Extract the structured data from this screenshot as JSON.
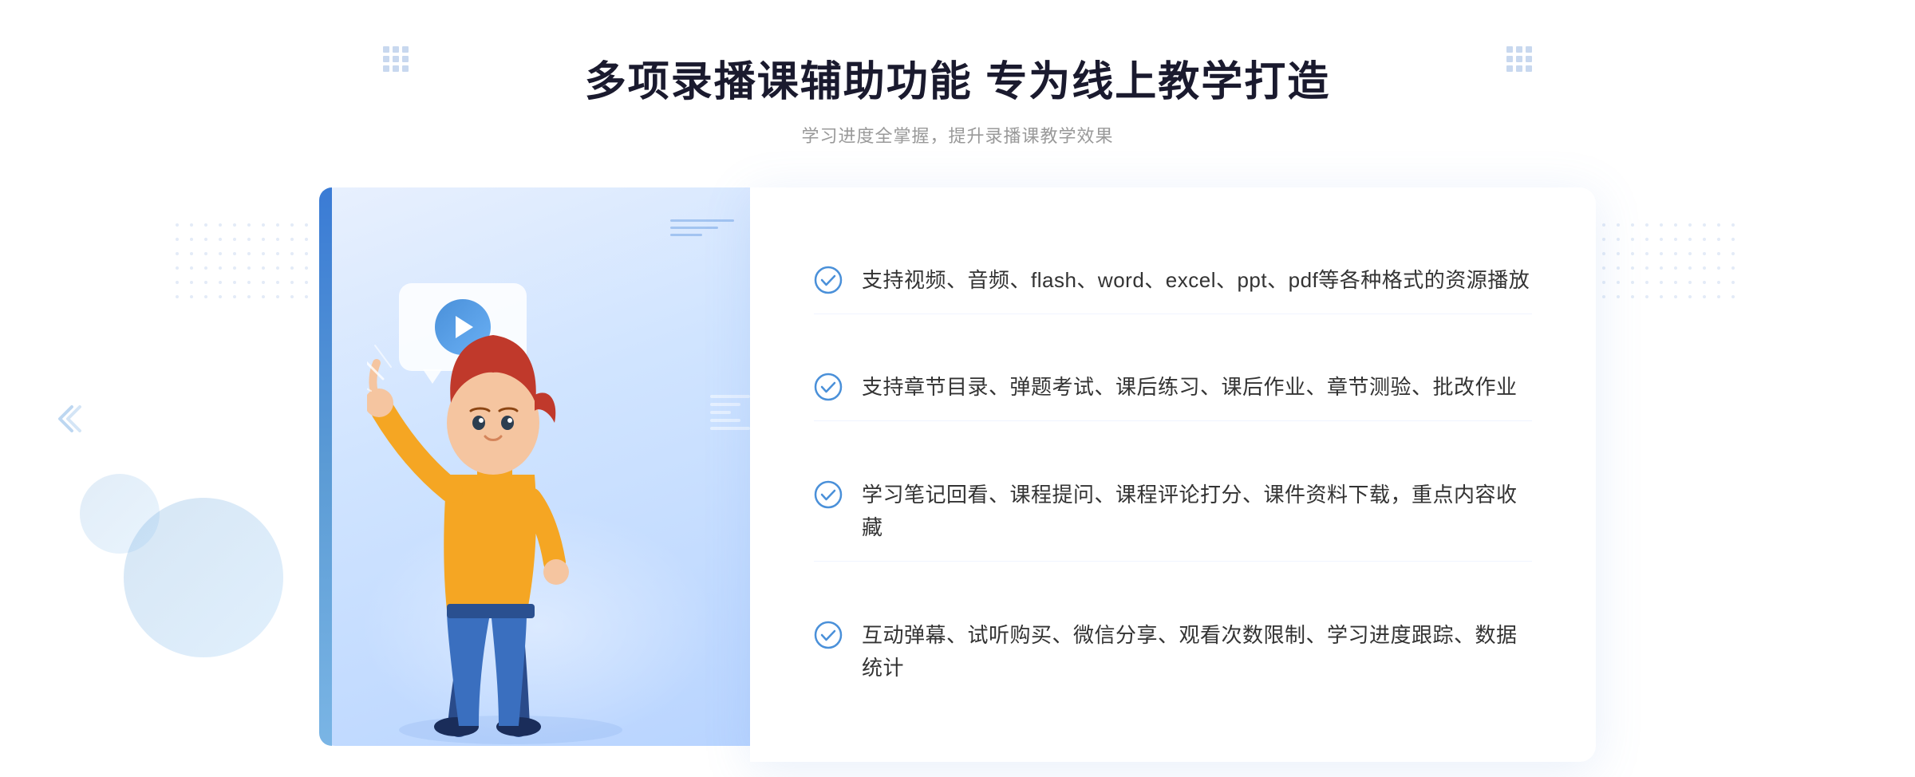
{
  "header": {
    "title": "多项录播课辅助功能 专为线上教学打造",
    "subtitle": "学习进度全掌握，提升录播课教学效果"
  },
  "features": [
    {
      "id": "feature-1",
      "text": "支持视频、音频、flash、word、excel、ppt、pdf等各种格式的资源播放"
    },
    {
      "id": "feature-2",
      "text": "支持章节目录、弹题考试、课后练习、课后作业、章节测验、批改作业"
    },
    {
      "id": "feature-3",
      "text": "学习笔记回看、课程提问、课程评论打分、课件资料下载，重点内容收藏"
    },
    {
      "id": "feature-4",
      "text": "互动弹幕、试听购买、微信分享、观看次数限制、学习进度跟踪、数据统计"
    }
  ],
  "icons": {
    "check": "check-circle-icon",
    "play": "play-icon",
    "arrow_left": "chevron-double-left-icon",
    "grid": "grid-decoration-icon"
  },
  "colors": {
    "primary": "#3a7bd5",
    "primary_light": "#5b9bd5",
    "text_dark": "#1a1a2e",
    "text_medium": "#333333",
    "text_light": "#999999",
    "bg_white": "#ffffff",
    "bg_card": "#eef3fd",
    "check_color": "#4a90d9",
    "border_light": "#f0f4ff"
  }
}
